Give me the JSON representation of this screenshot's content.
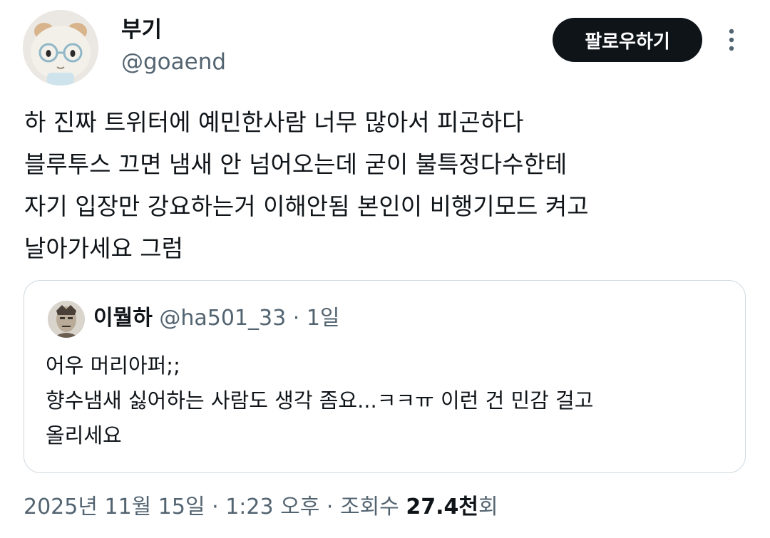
{
  "author": {
    "name": "부기",
    "handle": "@goaend"
  },
  "follow_label": "팔로우하기",
  "tweet_lines": [
    "하 진짜 트위터에 예민한사람 너무 많아서 피곤하다",
    "블루투스 끄면 냄새 안 넘어오는데 굳이 불특정다수한테",
    "자기 입장만 강요하는거 이해안됨 본인이 비행기모드 켜고",
    "날아가세요 그럼"
  ],
  "quote": {
    "name": "이뭘하",
    "handle": "@ha501_33",
    "separator": "·",
    "time": "1일",
    "lines": [
      "어우 머리아퍼;;",
      "향수냄새 싫어하는 사람도 생각 좀요...ㅋㅋㅠ 이런 건 민감 걸고",
      "올리세요"
    ]
  },
  "meta": {
    "date": "2025년 11월 15일",
    "sep1": "·",
    "time": "1:23 오후",
    "sep2": "·",
    "views_label": "조회수",
    "views_count": "27.4천",
    "views_unit": "회"
  },
  "icons": {
    "more": "more-vertical-icon"
  },
  "colors": {
    "text": "#0f1419",
    "secondary": "#536471",
    "border": "#cfd9de",
    "button_bg": "#0f1419"
  }
}
